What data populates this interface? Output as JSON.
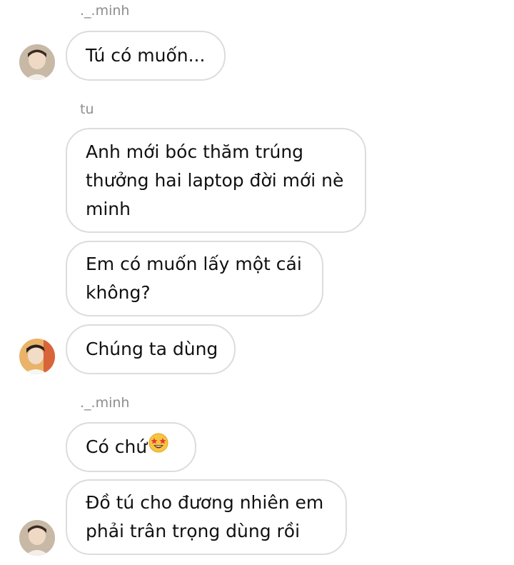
{
  "messages": [
    {
      "sender": "._.minh",
      "text": "Tú có muốn..."
    },
    {
      "sender": "tu",
      "texts": [
        "Anh mới bóc thăm trúng thưởng hai laptop đời mới nè minh",
        "Em có muốn lấy một cái không?",
        "Chúng ta dùng"
      ]
    },
    {
      "sender": "._.minh",
      "texts": [
        "Có chứ",
        "Đồ tú cho đương nhiên em phải trân trọng dùng rồi"
      ],
      "emoji": "star-struck"
    }
  ]
}
